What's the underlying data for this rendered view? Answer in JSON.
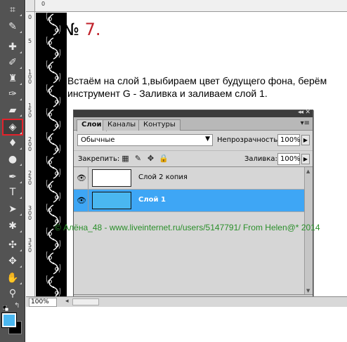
{
  "step": {
    "prefix": "№",
    "number": "7."
  },
  "instruction": "Встаём на слой 1,выбираем цвет будущего фона, берём инструмент G - Заливка и заливаем слой 1.",
  "rulers": {
    "top": [
      "0"
    ],
    "left": [
      "0",
      "5",
      "1 0 0",
      "1 5 0",
      "2 0 0",
      "2 5 0",
      "3 0 0",
      "3 5 0"
    ]
  },
  "toolbar": {
    "tools": [
      "crop-icon",
      "eyedropper-icon",
      "healing-brush-icon",
      "brush-icon",
      "clone-stamp-icon",
      "history-brush-icon",
      "eraser-icon",
      "paint-bucket-icon",
      "blur-icon",
      "dodge-icon",
      "pen-icon",
      "type-icon",
      "path-selection-icon",
      "custom-shape-icon",
      "3d-rotate-icon",
      "3d-orbit-icon",
      "hand-icon",
      "zoom-icon"
    ],
    "highlighted_tool": "paint-bucket-icon",
    "foreground_color": "#4ab7f0",
    "background_color": "#000000"
  },
  "layers_panel": {
    "tabs": [
      "Слои",
      "Каналы",
      "Контуры"
    ],
    "active_tab": "Слои",
    "blend_mode": "Обычные",
    "opacity_label": "Непрозрачность:",
    "opacity_value": "100%",
    "lock_label": "Закрепить:",
    "fill_label": "Заливка:",
    "fill_value": "100%",
    "layers": [
      {
        "name": "Слой 2 копия",
        "selected": false,
        "thumb_color": "#ffffff"
      },
      {
        "name": "Слой 1",
        "selected": true,
        "thumb_color": "#4ab7f0"
      }
    ],
    "footer_icons": [
      "link-icon",
      "fx-icon",
      "mask-icon",
      "adjustment-icon",
      "group-icon",
      "new-layer-icon",
      "trash-icon"
    ]
  },
  "watermark": "© Алёна_48 - www.liveinternet.ru/users/5147791/ From Helen@* 2014",
  "status": {
    "zoom": "100%"
  },
  "colors": {
    "accent_red": "#c0222b",
    "selection_blue": "#3ea6f5",
    "watermark_green": "#2a8f2a"
  }
}
